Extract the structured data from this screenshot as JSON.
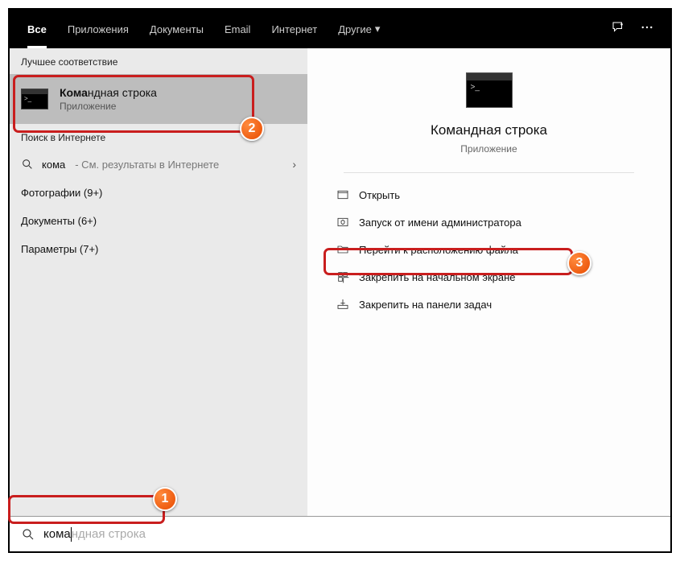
{
  "tabs": {
    "all": "Все",
    "apps": "Приложения",
    "docs": "Документы",
    "email": "Email",
    "internet": "Интернет",
    "more": "Другие"
  },
  "left": {
    "best_match_title": "Лучшее соответствие",
    "result": {
      "title_bold": "Кома",
      "title_rest": "ндная строка",
      "subtitle": "Приложение"
    },
    "web_search_title": "Поиск в Интернете",
    "web_query": "кома",
    "web_sub": " - См. результаты в Интернете",
    "photos": "Фотографии (9+)",
    "docs": "Документы (6+)",
    "params": "Параметры (7+)"
  },
  "right": {
    "app_name": "Командная строка",
    "app_type": "Приложение",
    "actions": {
      "open": "Открыть",
      "run_admin": "Запуск от имени администратора",
      "open_location": "Перейти к расположению файла",
      "pin_start": "Закрепить на начальном экране",
      "pin_taskbar": "Закрепить на панели задач"
    }
  },
  "search": {
    "typed": "кома",
    "ghost": "ндная строка"
  },
  "badges": {
    "b1": "1",
    "b2": "2",
    "b3": "3"
  }
}
